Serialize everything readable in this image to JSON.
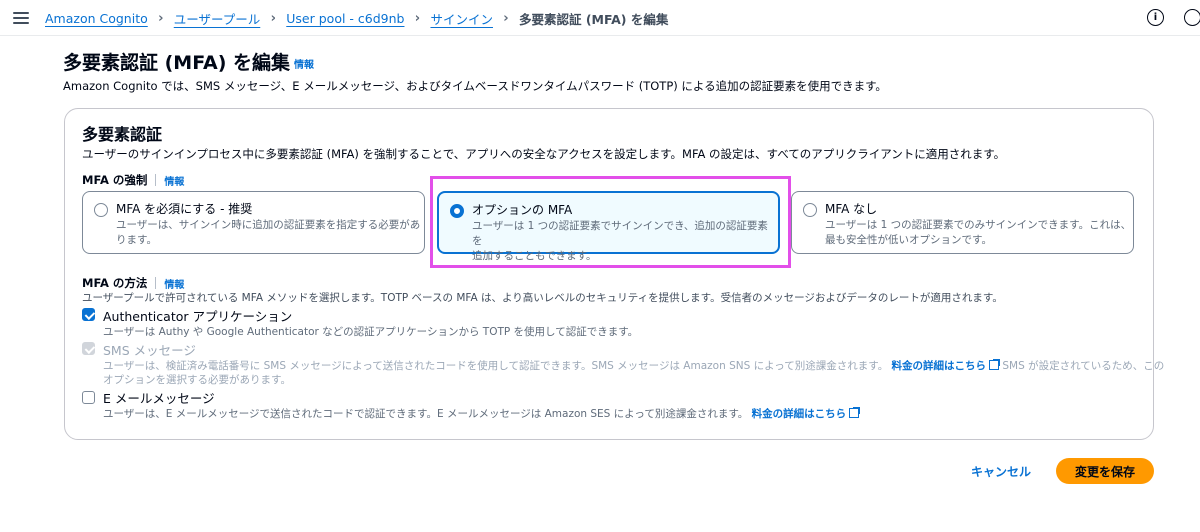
{
  "breadcrumbs": {
    "items": [
      "Amazon Cognito",
      "ユーザープール",
      "User pool - c6d9nb",
      "サインイン"
    ],
    "current": "多要素認証 (MFA) を編集"
  },
  "icons": {
    "menu": "menu-icon",
    "breadcrumb_separator": "chevron-right-icon",
    "info": "info-circle-icon",
    "notifications": "clock-icon",
    "radio": "radio-icon",
    "checkbox": "checkbox-icon",
    "external_link": "external-link-icon"
  },
  "header": {
    "title": "多要素認証 (MFA) を編集",
    "info_link": "情報",
    "description": "Amazon Cognito では、SMS メッセージ、E メールメッセージ、およびタイムベースドワンタイムパスワード (TOTP) による追加の認証要素を使用できます。"
  },
  "mfa_section": {
    "title": "多要素認証",
    "description": "ユーザーのサインインプロセス中に多要素認証 (MFA) を強制することで、アプリへの安全なアクセスを設定します。MFA の設定は、すべてのアプリクライアントに適用されます。",
    "enforcement": {
      "label": "MFA の強制",
      "info_link": "情報",
      "options": [
        {
          "label": "MFA を必須にする - 推奨",
          "description_line1": "ユーザーは、サインイン時に追加の認証要素を指定する必要があ",
          "description_line2": "ります。",
          "selected": false
        },
        {
          "label": "オプションの MFA",
          "description_line1": "ユーザーは 1 つの認証要素でサインインでき、追加の認証要素を",
          "description_line2": "追加することもできます。",
          "selected": true
        },
        {
          "label": "MFA なし",
          "description_line1": "ユーザーは 1 つの認証要素でのみサインインできます。これは、",
          "description_line2": "最も安全性が低いオプションです。",
          "selected": false
        }
      ]
    },
    "methods": {
      "label": "MFA の方法",
      "info_link": "情報",
      "description": "ユーザープールで許可されている MFA メソッドを選択します。TOTP ベースの MFA は、より高いレベルのセキュリティを提供します。受信者のメッセージおよびデータのレートが適用されます。",
      "authenticator": {
        "label": "Authenticator アプリケーション",
        "description": "ユーザーは Authy や Google Authenticator などの認証アプリケーションから TOTP を使用して認証できます。",
        "checked": true
      },
      "sms": {
        "label": "SMS メッセージ",
        "description_before": "ユーザーは、検証済み電話番号に SMS メッセージによって送信されたコードを使用して認証できます。SMS メッセージは Amazon SNS によって別途課金されます。",
        "pricing_link": "料金の詳細はこちら",
        "description_after": "SMS が設定されているため、この",
        "description_line2": "オプションを選択する必要があります。",
        "checked": true,
        "disabled": true
      },
      "email": {
        "label": "E メールメッセージ",
        "description": "ユーザーは、E メールメッセージで送信されたコードで認証できます。E メールメッセージは Amazon SES によって別途課金されます。",
        "pricing_link": "料金の詳細はこちら",
        "checked": false
      }
    }
  },
  "footer": {
    "cancel_label": "キャンセル",
    "save_label": "変更を保存"
  },
  "colors": {
    "link": "#0972d3",
    "primary_button": "#ff9900",
    "selected_tile_bg": "#f0fbff",
    "annotation_highlight": "#e24fe9"
  }
}
